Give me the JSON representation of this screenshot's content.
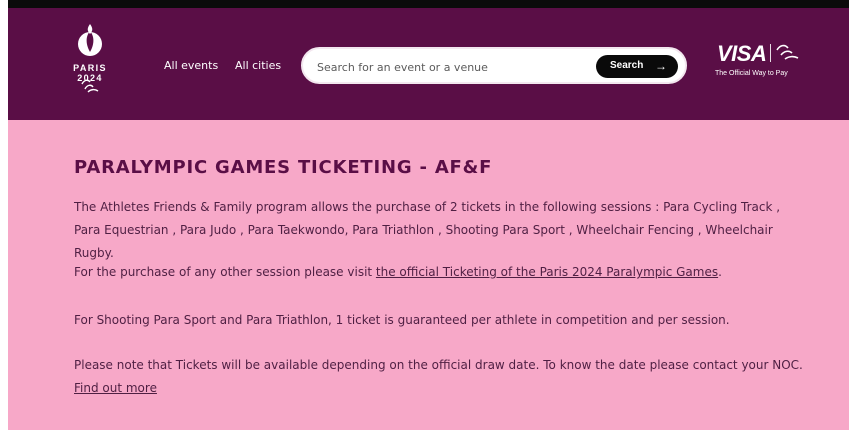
{
  "header": {
    "logo_text": "PARIS 2024",
    "nav": {
      "all_events": "All events",
      "all_cities": "All cities"
    },
    "search": {
      "placeholder": "Search for an event or a venue",
      "button_label": "Search",
      "arrow": "→"
    },
    "brand": {
      "visa": "VISA",
      "tagline": "The Official Way to Pay"
    }
  },
  "main": {
    "title": "PARALYMPIC GAMES TICKETING - AF&F",
    "paragraph_1": "The Athletes Friends & Family program allows the purchase of 2 tickets in the following sessions : Para Cycling Track , Para Equestrian , Para Judo , Para Taekwondo, Para Triathlon , Shooting Para Sport , Wheelchair Fencing , Wheelchair Rugby.",
    "paragraph_2_prefix": "For the purchase of any other session please visit ",
    "paragraph_2_link": "the official Ticketing of the Paris 2024 Paralympic Games",
    "paragraph_2_suffix": ".",
    "paragraph_3": "For Shooting Para Sport and Para Triathlon, 1 ticket is guaranteed per athlete in competition and per session.",
    "paragraph_4": "Please note that Tickets will be available depending on the official draw date. To know the date please contact your NOC.",
    "find_out_more": "Find out more"
  },
  "colors": {
    "header_bg": "#5a0e46",
    "content_bg": "#f7a8c8",
    "title_color": "#5a0e46",
    "text_color": "#4f1f43",
    "search_button_bg": "#0a0a0a"
  }
}
